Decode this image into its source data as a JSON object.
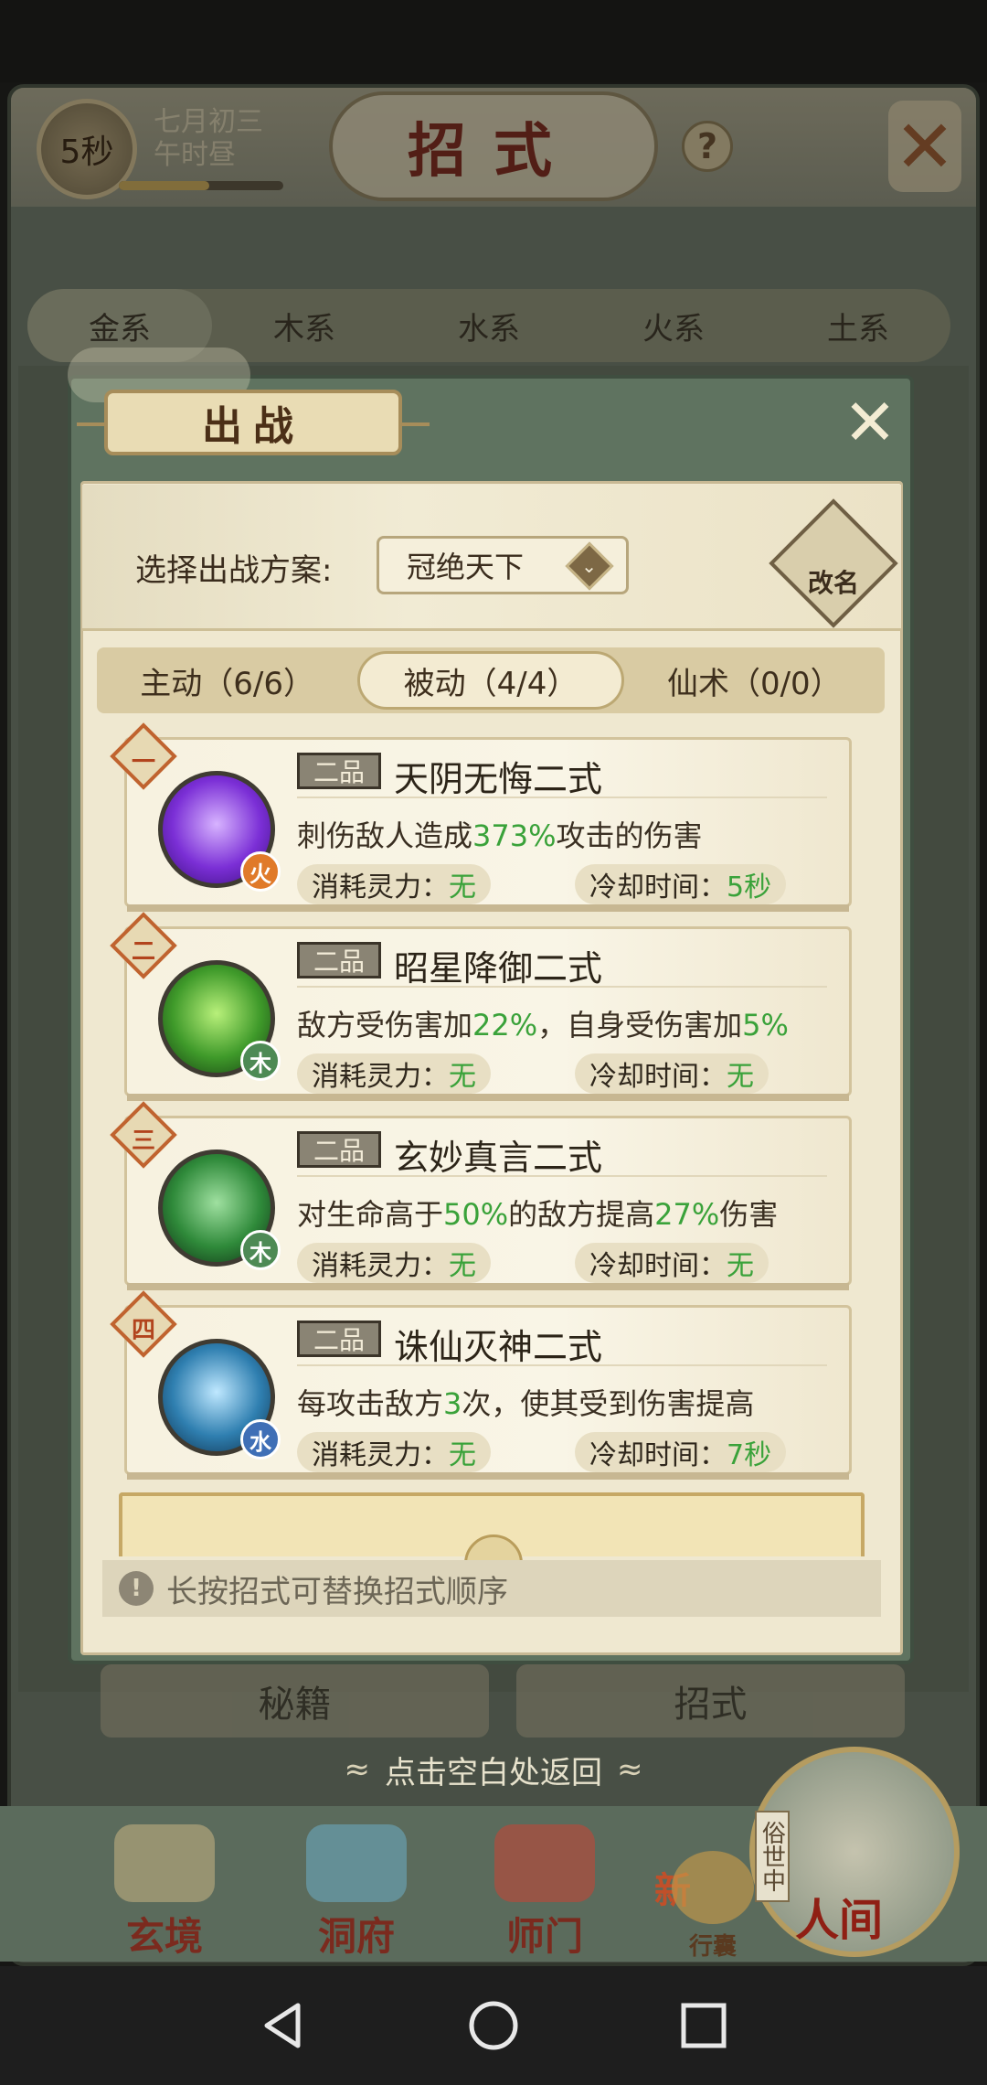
{
  "status": {
    "timer": "5秒",
    "date_line1": "七月初三",
    "date_line2": "午时昼",
    "date_progress": 0.55
  },
  "page": {
    "title": "招式",
    "help_icon": "?"
  },
  "element_tabs": [
    "金系",
    "木系",
    "水系",
    "火系",
    "土系"
  ],
  "lower_tabs": [
    "秘籍",
    "招式"
  ],
  "return_hint": "点击空白处返回",
  "bottom_nav": {
    "items": [
      "玄境",
      "洞府",
      "师门",
      "行囊"
    ],
    "item_new_badge": "新",
    "world_label": "人间",
    "world_tag": "俗世中"
  },
  "modal": {
    "title": "出战",
    "scheme_label": "选择出战方案:",
    "scheme_value": "冠绝天下",
    "rename_label": "改名",
    "tabs": [
      {
        "label": "主动（6/6）",
        "active": false
      },
      {
        "label": "被动（4/4）",
        "active": true
      },
      {
        "label": "仙术（0/0）",
        "active": false
      }
    ],
    "cost_label": "消耗灵力：",
    "cooldown_label": "冷却时间：",
    "skills": [
      {
        "rank": "一",
        "grade": "二品",
        "name": "天阴无悔二式",
        "element": "火",
        "element_color": "#e07a2a",
        "icon_colors": [
          "#d7b3ff",
          "#7b2fd6",
          "#3a0f7a"
        ],
        "desc_parts": [
          "刺伤敌人造成",
          "373%",
          "攻击的伤害",
          "",
          ""
        ],
        "cost": "无",
        "cooldown": "5秒"
      },
      {
        "rank": "二",
        "grade": "二品",
        "name": "昭星降御二式",
        "element": "木",
        "element_color": "#4d8a55",
        "icon_colors": [
          "#b8f07a",
          "#3f9a2a",
          "#153a12"
        ],
        "desc_parts": [
          "敌方受伤害加",
          "22%",
          "，自身受伤害加",
          "5%",
          ""
        ],
        "cost": "无",
        "cooldown": "无"
      },
      {
        "rank": "三",
        "grade": "二品",
        "name": "玄妙真言二式",
        "element": "木",
        "element_color": "#4d8a55",
        "icon_colors": [
          "#9fe0a0",
          "#2f8a3a",
          "#0f2c14"
        ],
        "desc_parts": [
          "对生命高于",
          "50%",
          "的敌方提高",
          "27%",
          "伤害"
        ],
        "cost": "无",
        "cooldown": "无"
      },
      {
        "rank": "四",
        "grade": "二品",
        "name": "诛仙灭神二式",
        "element": "水",
        "element_color": "#3f6fb6",
        "icon_colors": [
          "#bfe8ff",
          "#2f7fb0",
          "#0e2f4a"
        ],
        "desc_parts": [
          "每攻击敌方",
          "3",
          "次，使其受到伤害提高",
          "",
          ""
        ],
        "cost": "无",
        "cooldown": "7秒"
      }
    ],
    "tip": "长按招式可替换招式顺序",
    "tip_icon": "!"
  },
  "colors": {
    "highlight_green": "#3aa23a",
    "title_red": "#7a1d12"
  }
}
